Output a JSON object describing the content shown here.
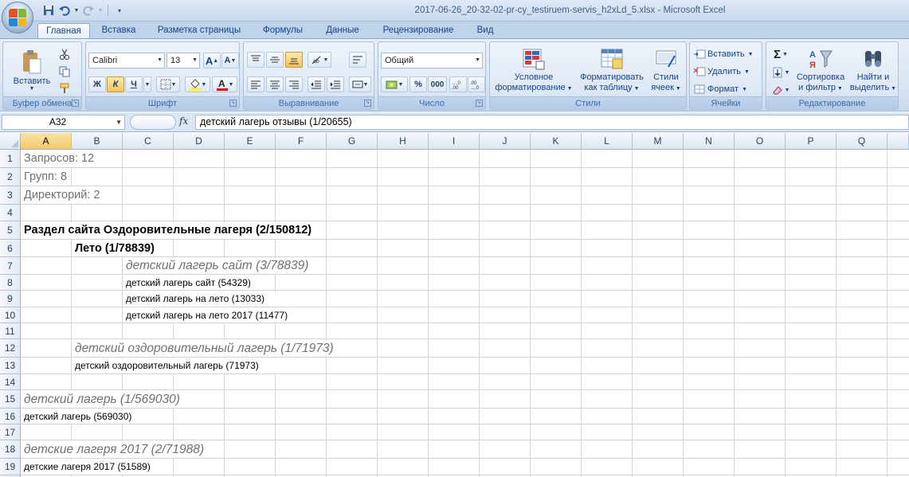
{
  "window": {
    "title": "2017-06-26_20-32-02-pr-cy_testiruem-servis_h2xLd_5.xlsx - Microsoft Excel"
  },
  "tabs": [
    "Главная",
    "Вставка",
    "Разметка страницы",
    "Формулы",
    "Данные",
    "Рецензирование",
    "Вид"
  ],
  "ribbon": {
    "clipboard": {
      "paste": "Вставить",
      "label": "Буфер обмена"
    },
    "font": {
      "name": "Calibri",
      "size": "13",
      "bold": "Ж",
      "italic": "К",
      "underline": "Ч",
      "grow": "A",
      "shrink": "A",
      "label": "Шрифт"
    },
    "alignment": {
      "label": "Выравнивание"
    },
    "number": {
      "format": "Общий",
      "percent": "%",
      "thousands": "000",
      "label": "Число"
    },
    "styles": {
      "conditional": [
        "Условное",
        "форматирование"
      ],
      "table": [
        "Форматировать",
        "как таблицу"
      ],
      "cell": [
        "Стили",
        "ячеек"
      ],
      "label": "Стили"
    },
    "cells": {
      "insert": "Вставить",
      "delete": "Удалить",
      "format": "Формат",
      "label": "Ячейки"
    },
    "editing": {
      "sort": [
        "Сортировка",
        "и фильтр"
      ],
      "find": [
        "Найти и",
        "выделить"
      ],
      "label": "Редактирование"
    }
  },
  "formula_bar": {
    "name_box": "A32",
    "fx": "fx",
    "content": "детский лагерь отзывы (1/20655)"
  },
  "columns": [
    "A",
    "B",
    "C",
    "D",
    "E",
    "F",
    "G",
    "H",
    "I",
    "J",
    "K",
    "L",
    "M",
    "N",
    "O",
    "P",
    "Q"
  ],
  "rows": [
    "1",
    "2",
    "3",
    "4",
    "5",
    "6",
    "7",
    "8",
    "9",
    "10",
    "11",
    "12",
    "13",
    "14",
    "15",
    "16",
    "17",
    "18",
    "19"
  ],
  "cells": {
    "r1": "Запросов: 12",
    "r2": "Групп: 8",
    "r3": "Директорий: 2",
    "r5": "Раздел сайта Оздоровительные лагеря (2/150812)",
    "r6": "Лето (1/78839)",
    "r7": "детский лагерь сайт (3/78839)",
    "r8": "детский лагерь сайт (54329)",
    "r9": "детский лагерь на лето (13033)",
    "r10": "детский лагерь на лето 2017 (11477)",
    "r12": "детский оздоровительный лагерь (1/71973)",
    "r13": "детский оздоровительный лагерь (71973)",
    "r15": "детский лагерь (1/569030)",
    "r16": "детский лагерь (569030)",
    "r18": "детские лагеря 2017 (2/71988)",
    "r19": "детские лагеря 2017 (51589)"
  },
  "selected_column": "A"
}
